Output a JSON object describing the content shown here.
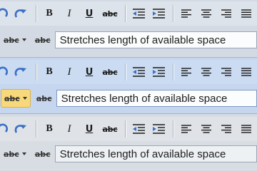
{
  "colors": {
    "panel1_toolbar_bg": "#dde3ea",
    "panel1_row_bg": "#d3dae3",
    "panel2_toolbar_bg": "#cbdcf2",
    "panel2_row_bg": "#c5d6ee",
    "panel3_toolbar_bg": "#dfe3e8",
    "panel3_row_bg": "#d8dde3",
    "undo_redo_blue": "#3b6fc6",
    "highlight_pill": "#f7d87a"
  },
  "icons": {
    "undo": "undo-arrow-icon",
    "redo": "redo-arrow-icon",
    "decrease_indent": "decrease-indent-icon",
    "increase_indent": "increase-indent-icon",
    "align_left": "align-left-icon",
    "align_center": "align-center-icon",
    "align_right": "align-right-icon",
    "justify": "justify-icon"
  },
  "format": {
    "bold": "B",
    "italic": "I",
    "underline": "U",
    "strikethrough": "abc"
  },
  "panels": [
    {
      "strike_dropdown": "abc",
      "strike_button": "abc",
      "stretch_text": "Stretches length of available space"
    },
    {
      "strike_dropdown": "abc",
      "strike_button": "abc",
      "stretch_text": "Stretches length of available space"
    },
    {
      "strike_dropdown": "abc",
      "strike_button": "abc",
      "stretch_text": "Stretches length of available space"
    }
  ]
}
